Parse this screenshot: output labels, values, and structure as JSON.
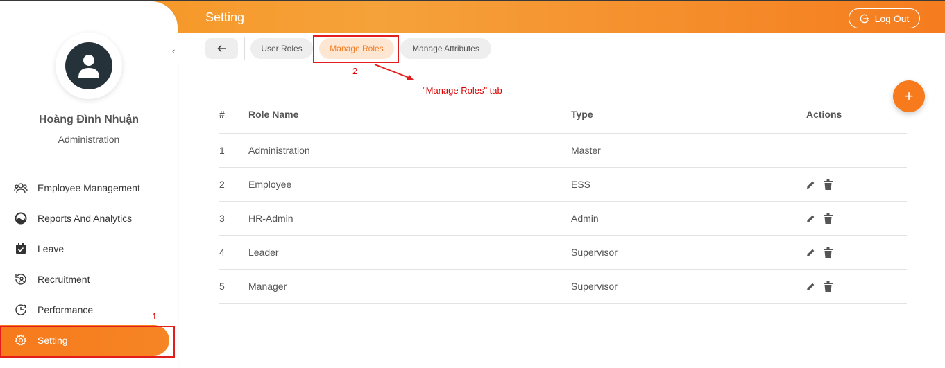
{
  "header": {
    "title": "Setting",
    "logout_label": "Log Out"
  },
  "sidebar": {
    "user_name": "Hoàng Đình Nhuận",
    "user_role": "Administration",
    "collapse_glyph": "‹",
    "items": [
      {
        "label": "Employee Management",
        "icon": "people-icon"
      },
      {
        "label": "Reports And Analytics",
        "icon": "chart-gauge-icon"
      },
      {
        "label": "Leave",
        "icon": "calendar-check-icon"
      },
      {
        "label": "Recruitment",
        "icon": "recruitment-icon"
      },
      {
        "label": "Performance",
        "icon": "performance-icon"
      },
      {
        "label": "Setting",
        "icon": "gear-icon",
        "active": true
      }
    ]
  },
  "tabs": [
    {
      "label": "User Roles",
      "active": false
    },
    {
      "label": "Manage Roles",
      "active": true
    },
    {
      "label": "Manage Attributes",
      "active": false
    }
  ],
  "annotations": {
    "num1": "1",
    "num2": "2",
    "callout": "\"Manage Roles\" tab"
  },
  "fab": {
    "symbol": "+"
  },
  "table": {
    "headers": {
      "num": "#",
      "name": "Role Name",
      "type": "Type",
      "actions": "Actions"
    },
    "rows": [
      {
        "num": "1",
        "name": "Administration",
        "type": "Master",
        "actions": false
      },
      {
        "num": "2",
        "name": "Employee",
        "type": "ESS",
        "actions": true
      },
      {
        "num": "3",
        "name": "HR-Admin",
        "type": "Admin",
        "actions": true
      },
      {
        "num": "4",
        "name": "Leader",
        "type": "Supervisor",
        "actions": true
      },
      {
        "num": "5",
        "name": "Manager",
        "type": "Supervisor",
        "actions": true
      }
    ]
  },
  "colors": {
    "accent": "#f77a1c",
    "annotation": "#e31c1c",
    "icon_dark": "#26323a"
  }
}
